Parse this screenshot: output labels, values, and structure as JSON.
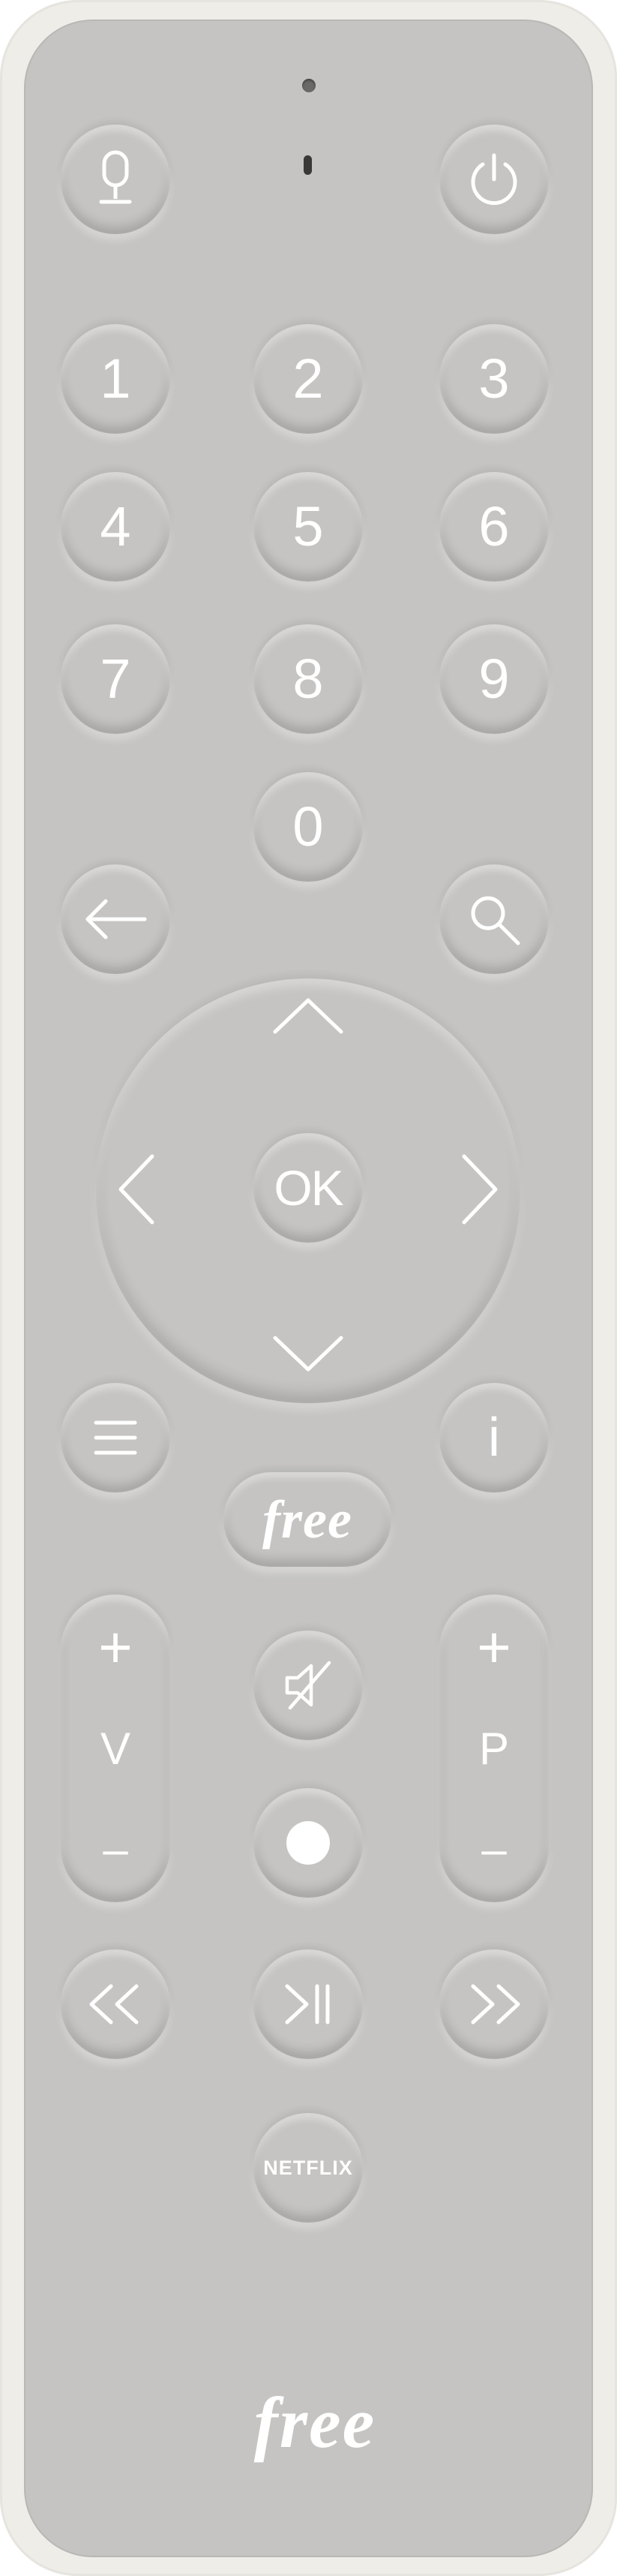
{
  "remote": {
    "brand": "free",
    "colors": {
      "face": "#c5c4c2",
      "shell": "#efede8",
      "legend": "#ffffff"
    },
    "top_row": [
      {
        "name": "microphone",
        "icon": "microphone-icon"
      },
      {
        "name": "power",
        "icon": "power-icon"
      }
    ],
    "number_keys": [
      "1",
      "2",
      "3",
      "4",
      "5",
      "6",
      "7",
      "8",
      "9",
      "0"
    ],
    "nav_row": [
      {
        "name": "back",
        "icon": "arrow-left-icon"
      },
      {
        "name": "search",
        "icon": "search-icon"
      }
    ],
    "dpad": {
      "center_label": "OK",
      "directions": [
        "up-chevron-icon",
        "left-chevron-icon",
        "right-chevron-icon",
        "down-chevron-icon"
      ]
    },
    "menu_row": [
      {
        "name": "menu",
        "icon": "menu-icon"
      },
      {
        "name": "info",
        "label": "i"
      }
    ],
    "free_key_label": "free",
    "volume": {
      "plus": "+",
      "letter": "V",
      "minus": "–"
    },
    "program": {
      "plus": "+",
      "letter": "P",
      "minus": "–"
    },
    "mute_icon": "mute-speaker-icon",
    "record_icon": "record-dot-icon",
    "transport": [
      {
        "name": "rewind",
        "icon": "rewind-icon"
      },
      {
        "name": "play-pause",
        "icon": "play-pause-icon"
      },
      {
        "name": "fast-forward",
        "icon": "fast-forward-icon"
      }
    ],
    "netflix_label": "NETFLIX",
    "bottom_logo": "free"
  }
}
